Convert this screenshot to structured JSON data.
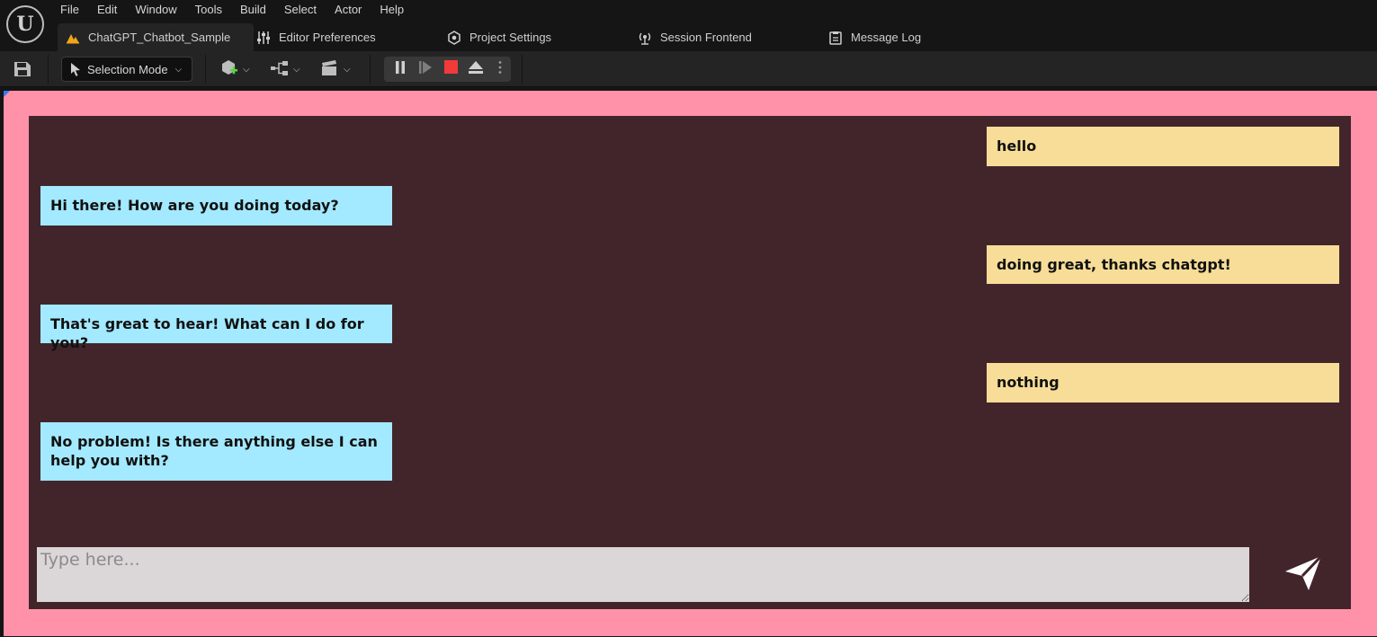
{
  "menubar": {
    "items": [
      "File",
      "Edit",
      "Window",
      "Tools",
      "Build",
      "Select",
      "Actor",
      "Help"
    ]
  },
  "tabs": [
    {
      "label": "ChatGPT_Chatbot_Sample",
      "icon": "level-icon",
      "active": true
    },
    {
      "label": "Editor Preferences",
      "icon": "sliders-icon"
    },
    {
      "label": "Project Settings",
      "icon": "settings-cube-icon"
    },
    {
      "label": "Session Frontend",
      "icon": "broadcast-icon"
    },
    {
      "label": "Message Log",
      "icon": "log-icon"
    }
  ],
  "toolbar": {
    "mode_label": "Selection Mode",
    "icons": [
      "save-icon",
      "add-actor-icon",
      "blueprint-icon",
      "cinematics-icon",
      "pause-icon",
      "frame-skip-icon",
      "stop-icon",
      "eject-icon",
      "more-options-icon"
    ]
  },
  "chat": {
    "messages": [
      {
        "role": "user",
        "text": "hello"
      },
      {
        "role": "bot",
        "text": "Hi there! How are you doing today?"
      },
      {
        "role": "user",
        "text": "doing great, thanks chatgpt!"
      },
      {
        "role": "bot",
        "text": "That's great to hear! What can I do for you?"
      },
      {
        "role": "user",
        "text": "nothing"
      },
      {
        "role": "bot",
        "text": "No problem! Is there anything else I can help you with?"
      }
    ],
    "input_placeholder": "Type here...",
    "input_value": ""
  },
  "colors": {
    "viewport_border": "#ff92a8",
    "chat_background": "#42252b",
    "bot_bubble": "#a3e9ff",
    "user_bubble": "#f7dd97",
    "input_background": "#dbd6d8",
    "stop_red": "#f23a3a",
    "tab_accent": "#f2a51b"
  }
}
